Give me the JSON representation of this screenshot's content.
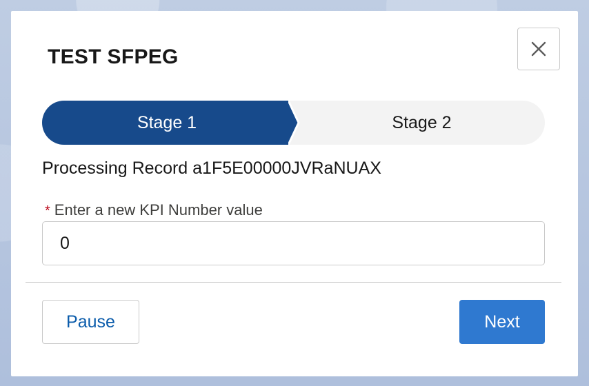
{
  "modal": {
    "title": "TEST SFPEG",
    "close_icon": "close-icon"
  },
  "path": {
    "stages": [
      {
        "label": "Stage 1",
        "state": "active"
      },
      {
        "label": "Stage 2",
        "state": "inactive"
      }
    ]
  },
  "record": {
    "text": "Processing Record a1F5E00000JVRaNUAX"
  },
  "field": {
    "required_mark": "*",
    "label": "Enter a new KPI Number value",
    "value": "0"
  },
  "footer": {
    "pause_label": "Pause",
    "next_label": "Next"
  },
  "colors": {
    "active_stage": "#174a8b",
    "inactive_stage": "#f3f3f3",
    "brand_button": "#2f79d0",
    "link_text": "#0b5cab",
    "required": "#ba0517"
  }
}
